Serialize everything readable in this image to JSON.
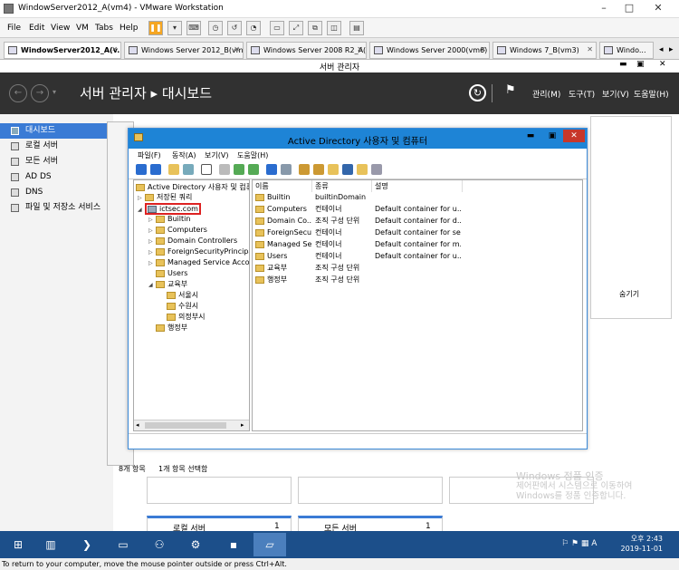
{
  "vmware": {
    "title": "WindowServer2012_A(vm4) - VMware Workstation",
    "menus": [
      "File",
      "Edit",
      "View",
      "VM",
      "Tabs",
      "Help"
    ],
    "tabs": [
      {
        "label": "WindowServer2012_A(v..."
      },
      {
        "label": "Windows Server 2012_B(vm5)"
      },
      {
        "label": "Windows Server 2008 R2_A(v..."
      },
      {
        "label": "Windows Server 2000(vm6)"
      },
      {
        "label": "Windows 7_B(vm3)"
      },
      {
        "label": "Windo..."
      }
    ],
    "status_bar": "To return to your computer, move the mouse pointer outside or press Ctrl+Alt."
  },
  "server_manager": {
    "window_title": "서버 관리자",
    "breadcrumb": "서버 관리자 ▸ 대시보드",
    "header_menus": [
      "관리(M)",
      "도구(T)",
      "보기(V)",
      "도움말(H)"
    ],
    "sidebar": [
      {
        "label": "대시보드",
        "selected": true
      },
      {
        "label": "로컬 서버"
      },
      {
        "label": "모든 서버"
      },
      {
        "label": "AD DS"
      },
      {
        "label": "DNS"
      },
      {
        "label": "파일 및 저장소 서비스"
      }
    ],
    "hide_label": "숨기기",
    "tiles": [
      {
        "label": "로컬 서버",
        "count": "1"
      },
      {
        "label": "모든 서버",
        "count": "1"
      }
    ],
    "status_left": "8개 항목",
    "status_right": "1개 항목 선택함"
  },
  "aduc": {
    "title": "Active Directory 사용자 및 컴퓨터",
    "menus": [
      "파일(F)",
      "동작(A)",
      "보기(V)",
      "도움말(H)"
    ],
    "tree": [
      {
        "label": "Active Directory 사용자 및 컴퓨",
        "level": 0
      },
      {
        "label": "저장된 쿼리",
        "level": 1
      },
      {
        "label": "ictsec.com",
        "level": 1,
        "highlighted": true
      },
      {
        "label": "Builtin",
        "level": 2
      },
      {
        "label": "Computers",
        "level": 2
      },
      {
        "label": "Domain Controllers",
        "level": 2
      },
      {
        "label": "ForeignSecurityPrincipal",
        "level": 2
      },
      {
        "label": "Managed Service Accou",
        "level": 2
      },
      {
        "label": "Users",
        "level": 2
      },
      {
        "label": "교육부",
        "level": 2
      },
      {
        "label": "서울시",
        "level": 3
      },
      {
        "label": "수원시",
        "level": 3
      },
      {
        "label": "의정부시",
        "level": 3
      },
      {
        "label": "행정부",
        "level": 2
      }
    ],
    "columns": [
      "이름",
      "종류",
      "설명"
    ],
    "rows": [
      {
        "name": "Builtin",
        "type": "builtinDomain",
        "desc": ""
      },
      {
        "name": "Computers",
        "type": "컨테이너",
        "desc": "Default container for u..."
      },
      {
        "name": "Domain Co...",
        "type": "조직 구성 단위",
        "desc": "Default container for d..."
      },
      {
        "name": "ForeignSecu...",
        "type": "컨테이너",
        "desc": "Default container for se..."
      },
      {
        "name": "Managed Se...",
        "type": "컨테이너",
        "desc": "Default container for m..."
      },
      {
        "name": "Users",
        "type": "컨테이너",
        "desc": "Default container for u..."
      },
      {
        "name": "교육부",
        "type": "조직 구성 단위",
        "desc": ""
      },
      {
        "name": "행정부",
        "type": "조직 구성 단위",
        "desc": ""
      }
    ]
  },
  "watermark": {
    "line1": "Windows 정품 인증",
    "line2": "제어판에서 시스템으로 이동하여",
    "line3": "Windows를 정품 인증합니다."
  },
  "taskbar": {
    "time": "오후 2:43",
    "date": "2019-11-01"
  }
}
